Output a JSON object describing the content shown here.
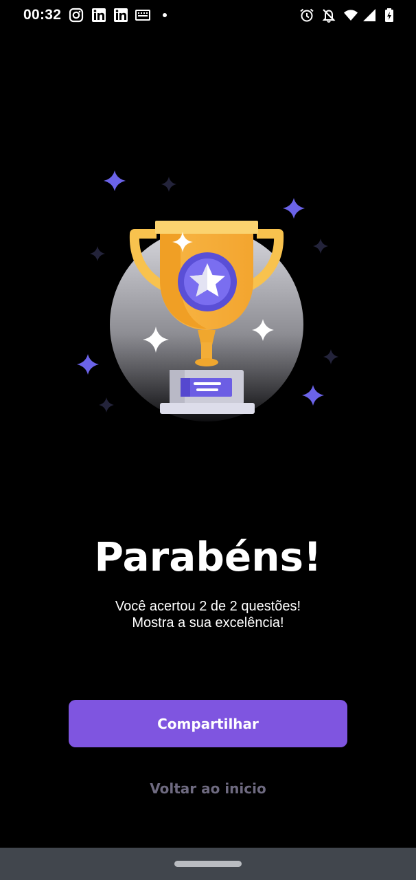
{
  "status_bar": {
    "time": "00:32",
    "left_icons": [
      "instagram-icon",
      "linkedin-icon",
      "linkedin-icon",
      "keyboard-icon",
      "dot-icon"
    ],
    "right_icons": [
      "alarm-icon",
      "notifications-off-icon",
      "wifi-icon",
      "cellular-signal-icon",
      "battery-charging-icon"
    ]
  },
  "result": {
    "illustration": "trophy-icon",
    "headline": "Parabéns!",
    "message_line1": "Você acertou 2 de 2 questões!",
    "message_line2": "Mostra a sua excelência!"
  },
  "actions": {
    "share_label": "Compartilhar",
    "back_label": "Voltar ao inicio"
  },
  "colors": {
    "background": "#000000",
    "accent": "#7f55e0",
    "secondary_text": "#6e6a80",
    "trophy_gold": "#f6b13d",
    "sparkle": "#6b63e8",
    "nav_bar": "#41464d"
  }
}
